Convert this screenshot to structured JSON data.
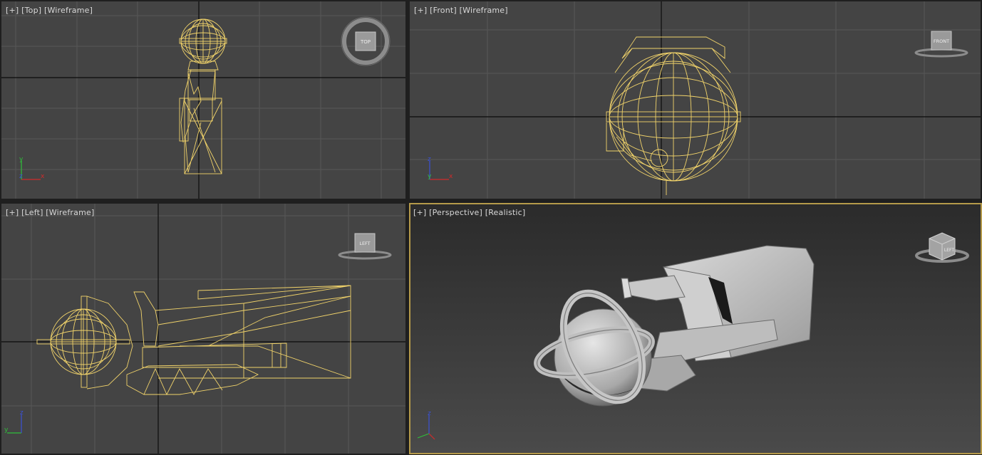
{
  "viewports": {
    "top": {
      "menu": "[+]",
      "view": "[Top]",
      "shading": "[Wireframe]",
      "cube_label": "TOP"
    },
    "front": {
      "menu": "[+]",
      "view": "[Front]",
      "shading": "[Wireframe]",
      "cube_label": "FRONT"
    },
    "left": {
      "menu": "[+]",
      "view": "[Left]",
      "shading": "[Wireframe]",
      "cube_label": "LEFT"
    },
    "perspective": {
      "menu": "[+]",
      "view": "[Perspective]",
      "shading": "[Realistic]",
      "cube_label": "LEFT",
      "active": true
    }
  },
  "axis_labels": {
    "x": "x",
    "y": "y",
    "z": "z"
  },
  "colors": {
    "viewport_bg": "#444444",
    "grid": "#575757",
    "axis_line": "#0b0b0b",
    "wireframe": "#f1d36a",
    "active_border": "#b59a4a",
    "axis_x": "#d12a2a",
    "axis_y": "#2fbf3a",
    "axis_z": "#3b52d6"
  }
}
